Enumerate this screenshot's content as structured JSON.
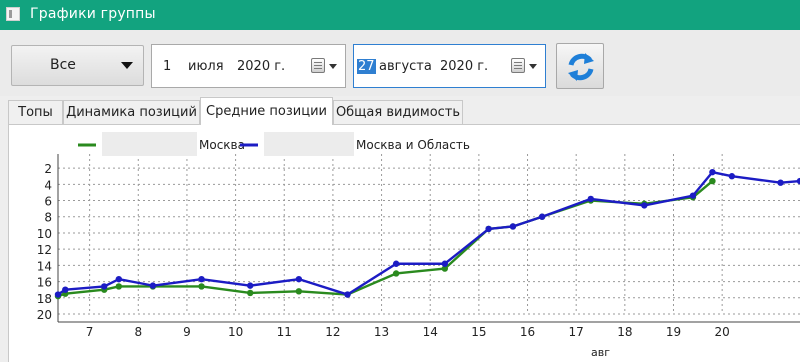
{
  "window": {
    "title": "Графики группы"
  },
  "toolbar": {
    "group_select": {
      "value": "Все"
    },
    "date_from": {
      "day": "1",
      "month": "июля",
      "year": "2020 г."
    },
    "date_to": {
      "day": "27",
      "month": "августа",
      "year": "2020 г."
    }
  },
  "tabs": [
    {
      "label": "Топы",
      "active": false
    },
    {
      "label": "Динамика позиций",
      "active": false
    },
    {
      "label": "Средние позиции",
      "active": true
    },
    {
      "label": "Общая видимость",
      "active": false
    }
  ],
  "colors": {
    "titlebar": "#12a37f",
    "series_moscow": "#2a8a1e",
    "series_moscow_region": "#1c1cc4",
    "refresh_icon": "#1e7fd8"
  },
  "icons": {
    "window": "app-window-icon",
    "dropdown": "chevron-down-icon",
    "calendar": "calendar-icon",
    "refresh": "refresh-icon"
  },
  "chart_data": {
    "type": "line",
    "title": "",
    "xlabel": "авг",
    "ylabel": "",
    "y_inverted": true,
    "ylim": [
      1,
      20
    ],
    "xlim": [
      6.35,
      21.6
    ],
    "y_ticks": [
      2,
      4,
      6,
      8,
      10,
      12,
      14,
      16,
      18,
      20
    ],
    "x_ticks": [
      7,
      8,
      9,
      10,
      11,
      12,
      13,
      14,
      15,
      16,
      17,
      18,
      19,
      20
    ],
    "grid": true,
    "legend_position": "top",
    "series": [
      {
        "name": "Москва",
        "legend_prefix_hidden": true,
        "color": "#2a8a1e",
        "x": [
          6.35,
          6.5,
          7.3,
          7.6,
          8.3,
          9.3,
          10.3,
          11.3,
          12.3,
          13.3,
          14.3,
          15.2,
          15.7,
          16.3,
          17.3,
          18.4,
          19.4,
          19.8
        ],
        "y": [
          17.8,
          17.5,
          17.0,
          16.6,
          16.6,
          16.6,
          17.4,
          17.2,
          17.6,
          15.0,
          14.4,
          9.5,
          9.2,
          8.0,
          6.0,
          6.4,
          5.6,
          3.6
        ]
      },
      {
        "name": "Москва и Область",
        "legend_prefix_hidden": true,
        "color": "#1c1cc4",
        "x": [
          6.35,
          6.5,
          7.3,
          7.6,
          8.3,
          9.3,
          10.3,
          11.3,
          12.3,
          13.3,
          14.3,
          15.2,
          15.7,
          16.3,
          17.3,
          18.4,
          19.4,
          19.8,
          20.2,
          21.2,
          21.6
        ],
        "y": [
          17.6,
          17.0,
          16.6,
          15.7,
          16.5,
          15.7,
          16.5,
          15.7,
          17.6,
          13.8,
          13.8,
          9.5,
          9.2,
          8.0,
          5.8,
          6.6,
          5.4,
          2.5,
          3.0,
          3.8,
          3.6
        ]
      }
    ]
  }
}
